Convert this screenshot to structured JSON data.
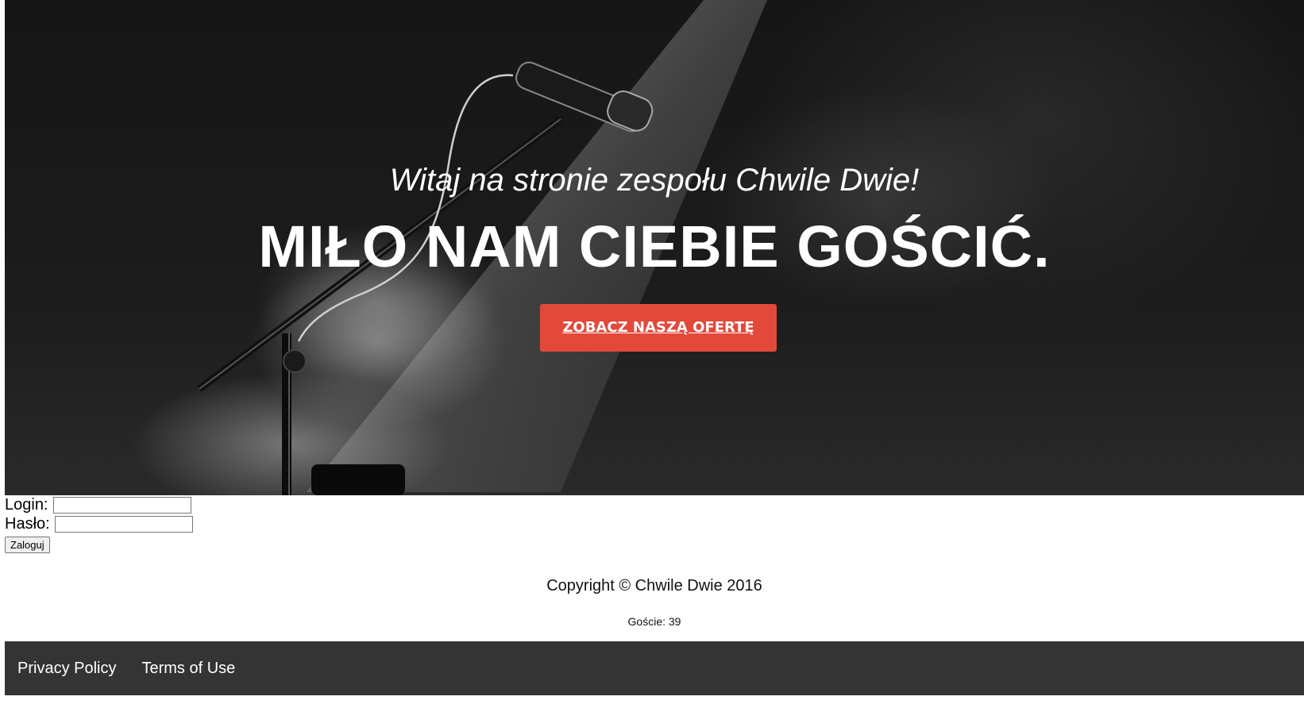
{
  "hero": {
    "welcome": "Witaj na stronie zespołu Chwile Dwie!",
    "headline": "MIŁO NAM CIEBIE GOŚCIĆ.",
    "cta_label": "ZOBACZ NASZĄ OFERTĘ",
    "cta_color": "#e2493b"
  },
  "login": {
    "login_label": "Login:",
    "password_label": "Hasło:",
    "login_value": "",
    "password_value": "",
    "submit_label": "Zaloguj"
  },
  "footer": {
    "copyright": "Copyright © Chwile Dwie 2016",
    "visitors": "Goście: 39",
    "links": [
      "Privacy Policy",
      "Terms of Use"
    ],
    "bar_color": "#343434"
  }
}
